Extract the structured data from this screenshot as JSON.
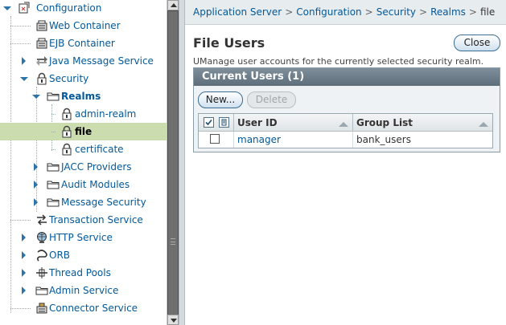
{
  "tree": {
    "items": [
      {
        "label": "Configuration",
        "icon": "configuration-icon",
        "depth": 0,
        "state": "expanded",
        "bold": false
      },
      {
        "label": "Web Container",
        "icon": "web-container-icon",
        "depth": 1,
        "state": "leaf",
        "bold": false
      },
      {
        "label": "EJB Container",
        "icon": "ejb-container-icon",
        "depth": 1,
        "state": "leaf",
        "bold": false
      },
      {
        "label": "Java Message Service",
        "icon": "jms-icon",
        "depth": 1,
        "state": "collapsed",
        "bold": false
      },
      {
        "label": "Security",
        "icon": "lock-icon",
        "depth": 1,
        "state": "expanded",
        "bold": false
      },
      {
        "label": "Realms",
        "icon": "folder-icon",
        "depth": 2,
        "state": "expanded",
        "bold": true
      },
      {
        "label": "admin-realm",
        "icon": "lock-icon",
        "depth": 3,
        "state": "leaf",
        "bold": false
      },
      {
        "label": "file",
        "icon": "lock-icon",
        "depth": 3,
        "state": "leaf",
        "bold": true,
        "selected": true
      },
      {
        "label": "certificate",
        "icon": "lock-icon",
        "depth": 3,
        "state": "leaf",
        "bold": false
      },
      {
        "label": "JACC Providers",
        "icon": "folder-icon",
        "depth": 2,
        "state": "collapsed",
        "bold": false
      },
      {
        "label": "Audit Modules",
        "icon": "folder-icon",
        "depth": 2,
        "state": "collapsed",
        "bold": false
      },
      {
        "label": "Message Security",
        "icon": "folder-icon",
        "depth": 2,
        "state": "collapsed",
        "bold": false
      },
      {
        "label": "Transaction Service",
        "icon": "transaction-icon",
        "depth": 1,
        "state": "leaf",
        "bold": false
      },
      {
        "label": "HTTP Service",
        "icon": "globe-icon",
        "depth": 1,
        "state": "collapsed",
        "bold": false
      },
      {
        "label": "ORB",
        "icon": "orb-icon",
        "depth": 1,
        "state": "collapsed",
        "bold": false
      },
      {
        "label": "Thread Pools",
        "icon": "thread-pool-icon",
        "depth": 1,
        "state": "collapsed",
        "bold": false
      },
      {
        "label": "Admin Service",
        "icon": "folder-icon",
        "depth": 1,
        "state": "collapsed",
        "bold": false
      },
      {
        "label": "Connector Service",
        "icon": "connector-icon",
        "depth": 1,
        "state": "leaf",
        "bold": false
      }
    ]
  },
  "breadcrumb": {
    "items": [
      "Application Server",
      "Security",
      "Realms"
    ],
    "first": "Application Server",
    "second": "Configuration",
    "third": "Security",
    "fourth": "Realms",
    "current": "file",
    "separator": ">"
  },
  "page": {
    "title": "File Users",
    "close_label": "Close",
    "help_text": "UManage user accounts for the currently selected security realm."
  },
  "table": {
    "caption": "Current Users (1)",
    "new_label": "New...",
    "delete_label": "Delete",
    "columns": [
      "User ID",
      "Group List"
    ],
    "rows": [
      {
        "user_id": "manager",
        "group_list": "bank_users"
      }
    ]
  },
  "colors": {
    "link": "#035899",
    "selected_row": "#cbdcaf",
    "table_header": "#5d6e7a",
    "breadcrumb_bg": "#e7ecef"
  }
}
